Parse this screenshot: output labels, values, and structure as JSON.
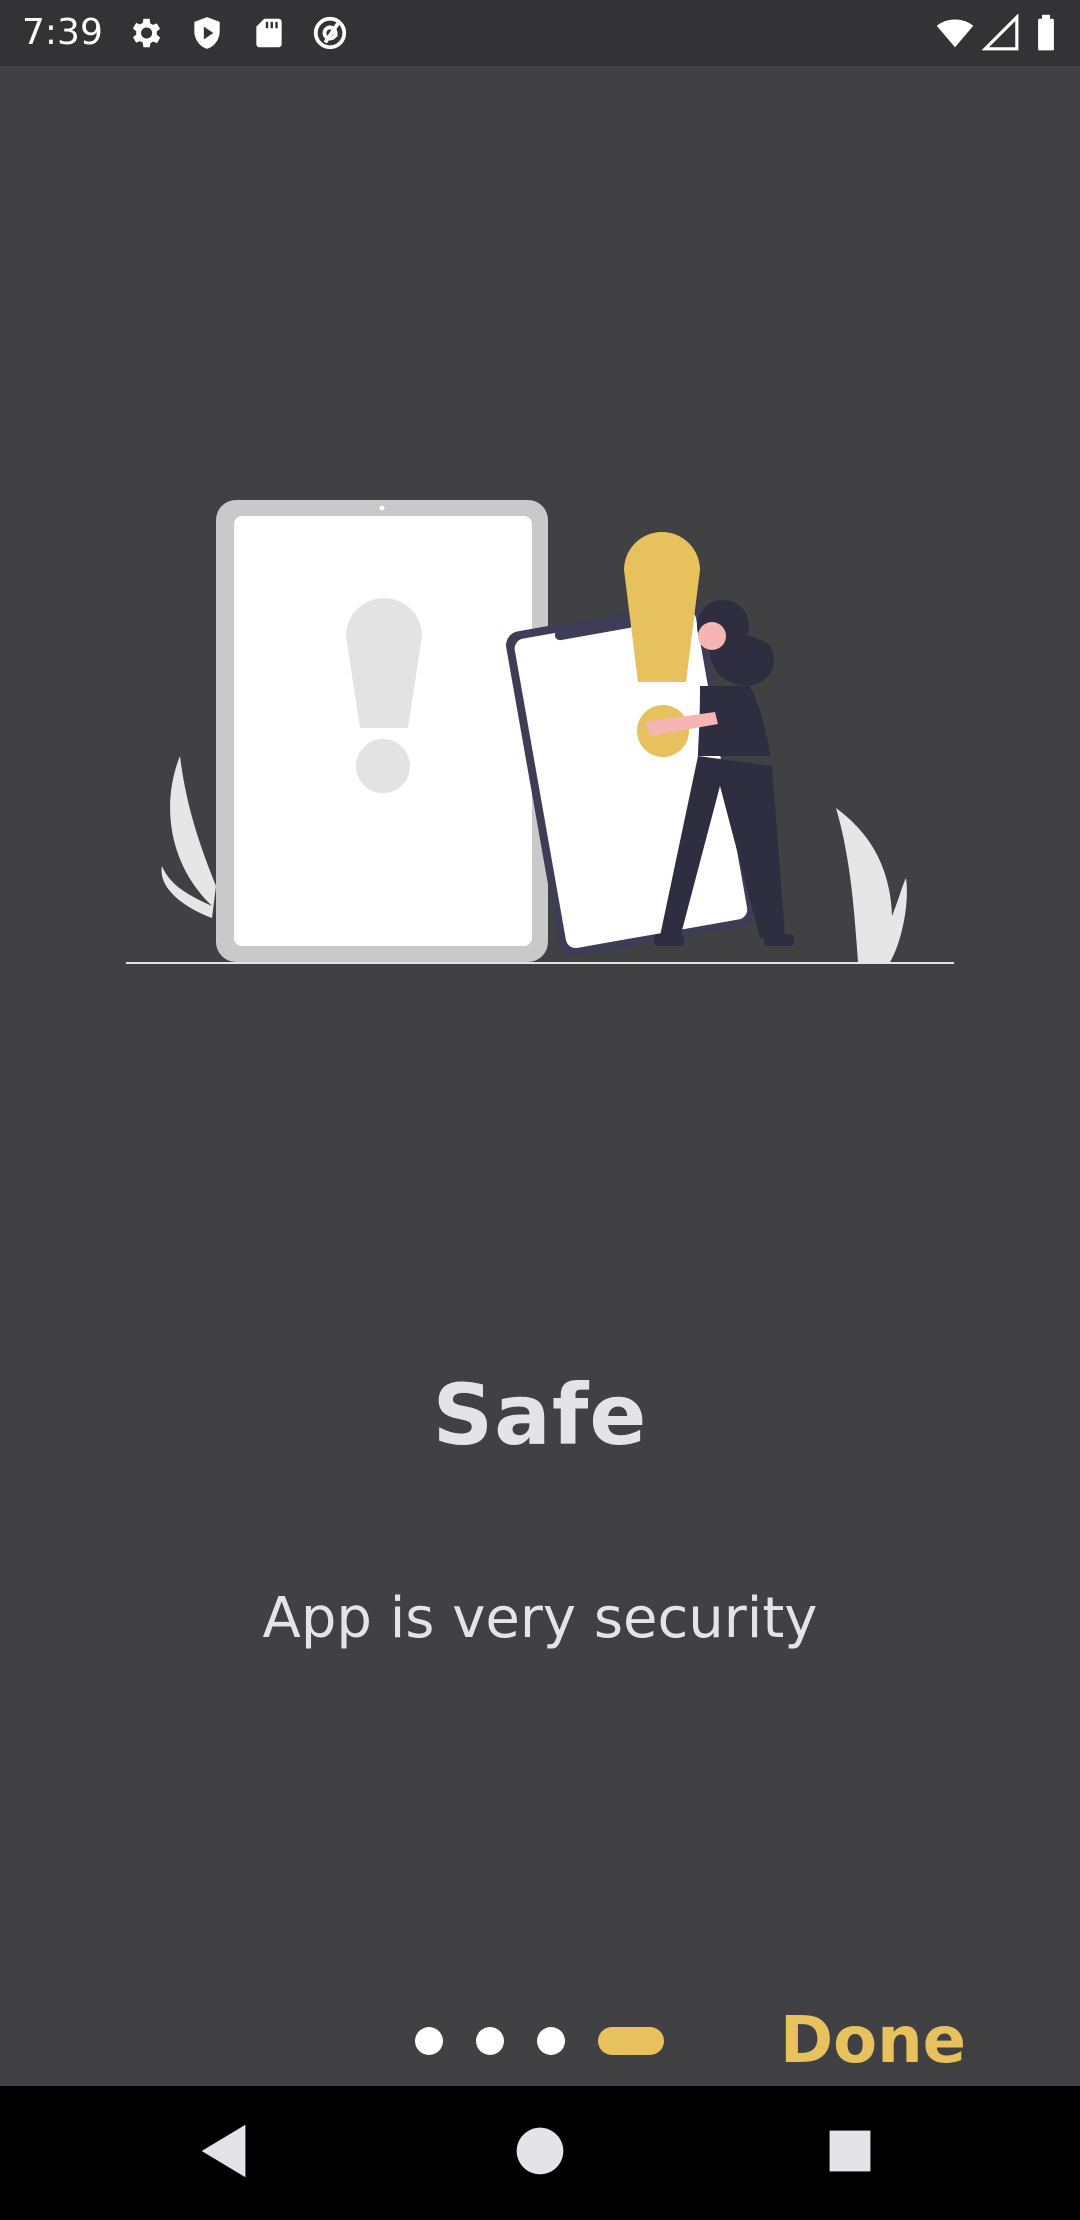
{
  "status_bar": {
    "time": "7:39",
    "left_icons": [
      "gear-icon",
      "shield-play-icon",
      "sd-card-icon",
      "at-sign-icon"
    ],
    "right_icons": [
      "wifi-icon",
      "signal-icon",
      "battery-icon"
    ]
  },
  "onboarding": {
    "title": "Safe",
    "subtitle": "App is very security",
    "page_indicator": {
      "total": 4,
      "active": 4
    },
    "done_label": "Done"
  },
  "colors": {
    "background": "#414144",
    "accent": "#e6c15e",
    "text": "#e4e4e7"
  },
  "nav_bar": [
    "back-icon",
    "home-icon",
    "recents-icon"
  ]
}
